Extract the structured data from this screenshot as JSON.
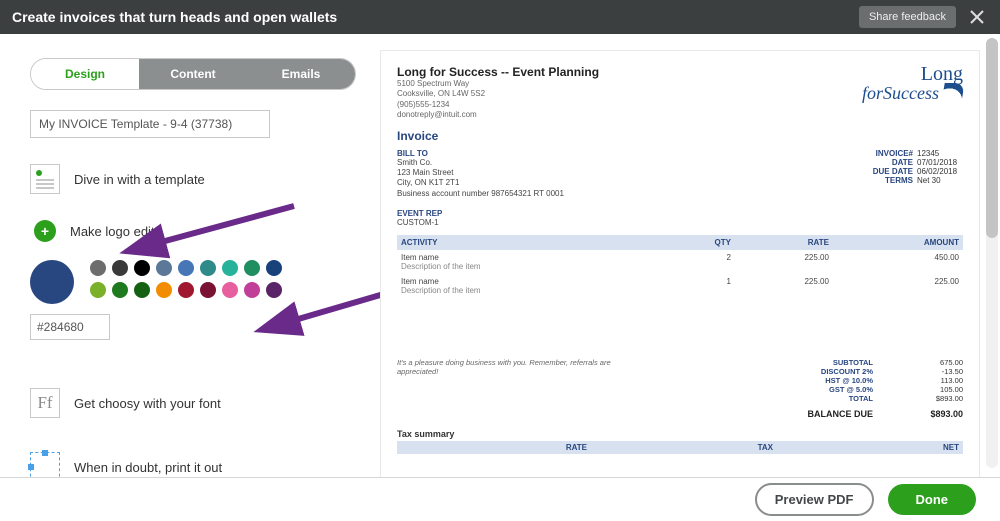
{
  "header": {
    "title": "Create invoices that turn heads and open wallets",
    "feedback": "Share feedback"
  },
  "tabs": {
    "design": "Design",
    "content": "Content",
    "emails": "Emails"
  },
  "template_name": "My INVOICE Template - 9-4 (37738)",
  "sections": {
    "template": "Dive in with a template",
    "logo": "Make logo edits",
    "font": "Get choosy with your font",
    "print": "When in doubt, print it out"
  },
  "colors": {
    "selected": "#284680",
    "hex_field": "#284680",
    "row1": [
      "#6d6d6d",
      "#3a3a3a",
      "#000000",
      "#5b7898",
      "#4676b6",
      "#2f8a8a",
      "#27b39a",
      "#1f8f62",
      "#19427a"
    ],
    "row2": [
      "#7bb02a",
      "#1f7a1f",
      "#146114",
      "#f28c00",
      "#a01830",
      "#7a1234",
      "#e85fa0",
      "#c23f99",
      "#5a2468"
    ]
  },
  "footer": {
    "preview": "Preview PDF",
    "done": "Done"
  },
  "preview": {
    "company": "Long for Success -- Event Planning",
    "addr1": "5100 Spectrum Way",
    "addr2": "Cooksville, ON L4W 5S2",
    "phone": "(905)555-1234",
    "email": "donotreply@intuit.com",
    "logo_top": "Long",
    "logo_for": "for",
    "logo_bottom": "Success",
    "doc_title": "Invoice",
    "billto_label": "BILL TO",
    "bill_name": "Smith Co.",
    "bill_street": "123 Main Street",
    "bill_city": "City, ON K1T 2T1",
    "bill_acct": "Business account number  987654321 RT 0001",
    "meta": {
      "invno_k": "INVOICE#",
      "invno_v": "12345",
      "date_k": "DATE",
      "date_v": "07/01/2018",
      "due_k": "DUE DATE",
      "due_v": "06/02/2018",
      "terms_k": "TERMS",
      "terms_v": "Net 30"
    },
    "eventrep_label": "EVENT REP",
    "eventrep_val": "CUSTOM-1",
    "cols": {
      "activity": "ACTIVITY",
      "qty": "QTY",
      "rate": "RATE",
      "amount": "AMOUNT"
    },
    "items": [
      {
        "name": "Item name",
        "desc": "Description of the item",
        "qty": "2",
        "rate": "225.00",
        "amount": "450.00"
      },
      {
        "name": "Item name",
        "desc": "Description of the item",
        "qty": "1",
        "rate": "225.00",
        "amount": "225.00"
      }
    ],
    "note": "It's a pleasure doing business with you. Remember, referrals are appreciated!",
    "totals": {
      "subtotal_k": "SUBTOTAL",
      "subtotal_v": "675.00",
      "discount_k": "DISCOUNT 2%",
      "discount_v": "-13.50",
      "hst_k": "HST @ 10.0%",
      "hst_v": "113.00",
      "gst_k": "GST @ 5.0%",
      "gst_v": "105.00",
      "total_k": "TOTAL",
      "total_v": "$893.00",
      "bal_k": "BALANCE DUE",
      "bal_v": "$893.00"
    },
    "tax_summary": "Tax summary",
    "tax_cols": {
      "rate": "RATE",
      "tax": "TAX",
      "net": "NET"
    }
  }
}
